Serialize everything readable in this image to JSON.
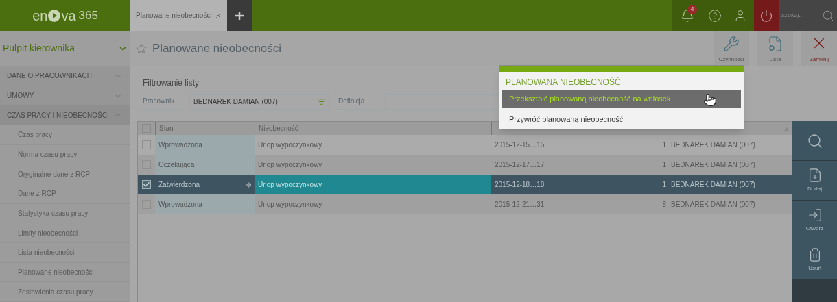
{
  "top_bar": {
    "logo": {
      "part_1": "en",
      "part_2": "va",
      "number": "365"
    },
    "tabs": [
      {
        "label": "Planowane nieobecności",
        "selected": true
      }
    ],
    "notifications_badge": "4",
    "search": {
      "placeholder": "szukaj..."
    }
  },
  "workspace": {
    "title": "Pulpit kierownika"
  },
  "page": {
    "title": "Planowane nieobecności",
    "starred": false
  },
  "toolbar": [
    {
      "label": "Czynności",
      "kind": "wrench"
    },
    {
      "label": "Lista",
      "kind": "list"
    },
    {
      "label": "Zamknij",
      "kind": "close"
    }
  ],
  "sidebar": {
    "sections": [
      {
        "label": "DANE O PRACOWNIKACH",
        "expanded": false
      },
      {
        "label": "UMOWY",
        "expanded": false
      },
      {
        "label": "CZAS PRACY I NIEOBECNOŚCI",
        "expanded": true,
        "children": [
          {
            "label": "Czas pracy"
          },
          {
            "label": "Norma czasu pracy"
          },
          {
            "label": "Oryginalne dane z RCP"
          },
          {
            "label": "Dane z RCP"
          },
          {
            "label": "Statystyka czasu pracy"
          },
          {
            "label": "Limity nieobecności"
          },
          {
            "label": "Lista nieobecności"
          },
          {
            "label": "Planowane nieobecności"
          },
          {
            "label": "Zestawienia czasu pracy"
          }
        ]
      }
    ]
  },
  "filter": {
    "title": "Filtrowanie listy",
    "fields": [
      {
        "label": "Pracownik",
        "value": "BEDNAREK DAMIAN (007)",
        "kind": "picker"
      },
      {
        "label": "Definicja",
        "kind": "text"
      }
    ]
  },
  "table": {
    "all_checked": false,
    "columns": [
      "Stan",
      "Nieobecność"
    ],
    "rows": [
      {
        "selected": false,
        "checked": false,
        "stan": "Wprowadzona",
        "nieobecnosc": "Urlop wypoczynkowy",
        "column_3": "2015-12-15…15",
        "column_4": "1",
        "column_5": "BEDNAREK DAMIAN (007)"
      },
      {
        "selected": false,
        "checked": false,
        "stan": "Oczekująca",
        "nieobecnosc": "Urlop wypoczynkowy",
        "column_3": "2015-12-17…17",
        "column_4": "1",
        "column_5": "BEDNAREK DAMIAN (007)"
      },
      {
        "selected": true,
        "checked": true,
        "stan": "Zatwierdzona",
        "nieobecnosc": "Urlop wypoczynkowy",
        "column_3": "2015-12-18…18",
        "column_4": "1",
        "column_5": "BEDNAREK DAMIAN (007)"
      },
      {
        "selected": false,
        "checked": false,
        "stan": "Wprowadzona",
        "nieobecnosc": "Urlop wypoczynkowy",
        "column_3": "2015-12-21…31",
        "column_4": "8",
        "column_5": "BEDNAREK DAMIAN (007)"
      }
    ]
  },
  "actions": [
    {
      "kind": "search"
    },
    {
      "kind": "add",
      "label": "Dodaj"
    },
    {
      "kind": "open",
      "label": "Otwórz"
    },
    {
      "kind": "delete",
      "label": "Usuń"
    }
  ],
  "popup": {
    "title": "PLANOWANA NIEOBECNOŚĆ",
    "items": [
      {
        "label": "Przekształć planowaną nieobecność na wniosek",
        "selected": true
      },
      {
        "label": "Przywróć planowaną nieobecność",
        "selected": false
      }
    ]
  }
}
